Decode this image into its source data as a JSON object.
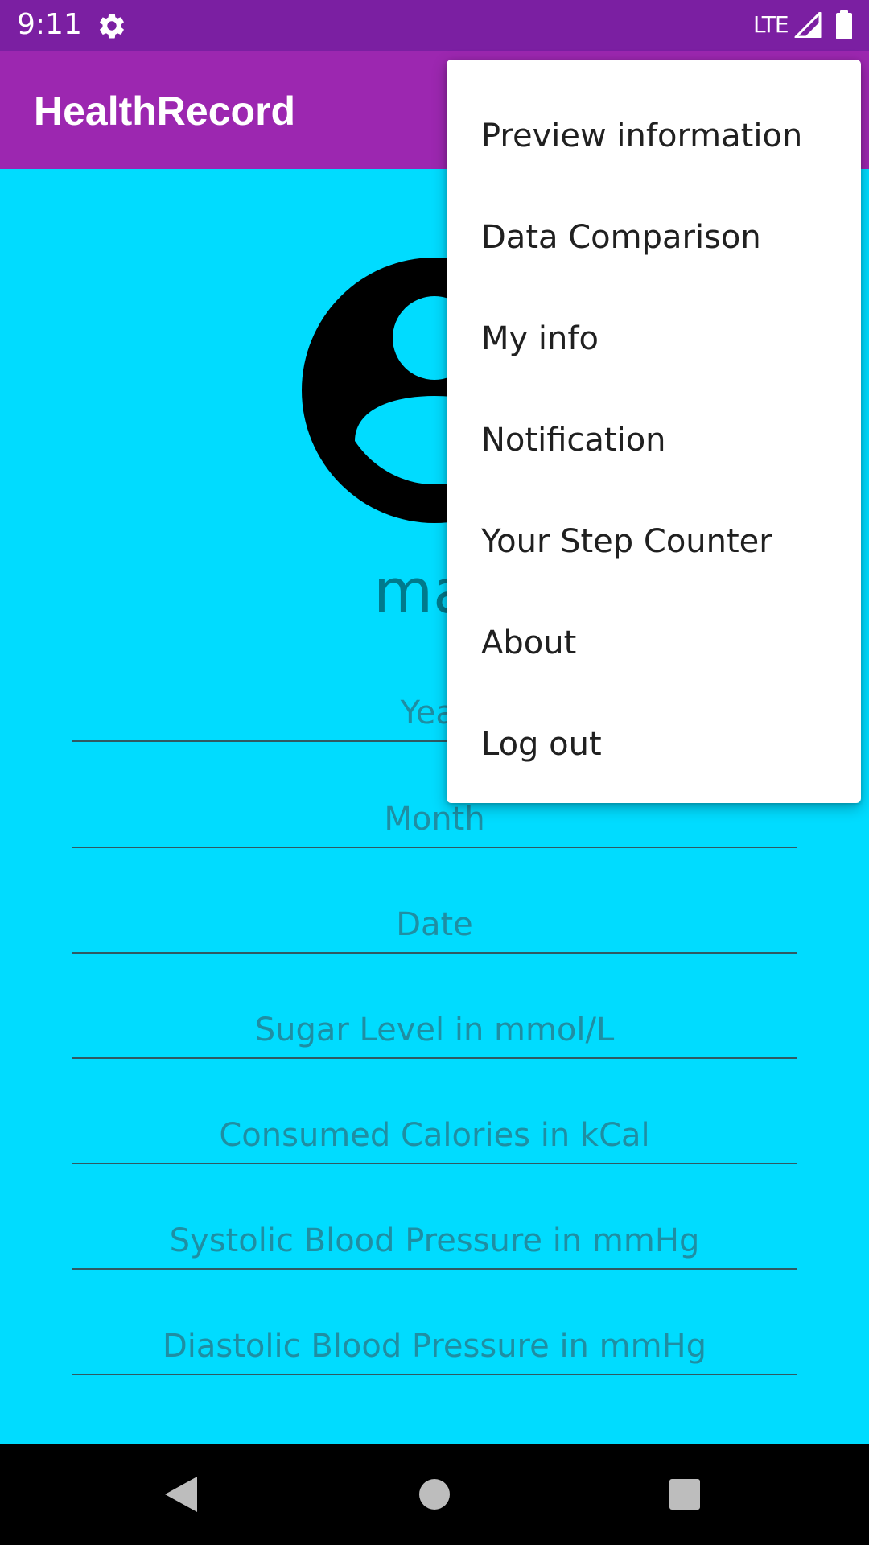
{
  "status_bar": {
    "time": "9:11",
    "network": "LTE",
    "icons": [
      "gear-icon",
      "signal-icon",
      "battery-icon"
    ]
  },
  "app_bar": {
    "title": "HealthRecord",
    "background": "#9c27b0",
    "status_background": "#7b1fa2"
  },
  "profile": {
    "name": "mar",
    "avatar_icon": "account-circle-icon"
  },
  "fields": {
    "year": "Year",
    "month": "Month",
    "date": "Date",
    "sugar": "Sugar Level in mmol/L",
    "calories": "Consumed Calories in kCal",
    "systolic": "Systolic Blood Pressure in mmHg",
    "diastolic": "Diastolic Blood Pressure in mmHg"
  },
  "menu": {
    "items": [
      "Preview information",
      "Data Comparison",
      "My info",
      "Notification",
      "Your Step Counter",
      "About",
      "Log out"
    ]
  },
  "nav": {
    "icons": [
      "back-icon",
      "home-icon",
      "recents-icon"
    ]
  },
  "colors": {
    "content_background": "#00dcff",
    "name_text": "#007a8c"
  }
}
